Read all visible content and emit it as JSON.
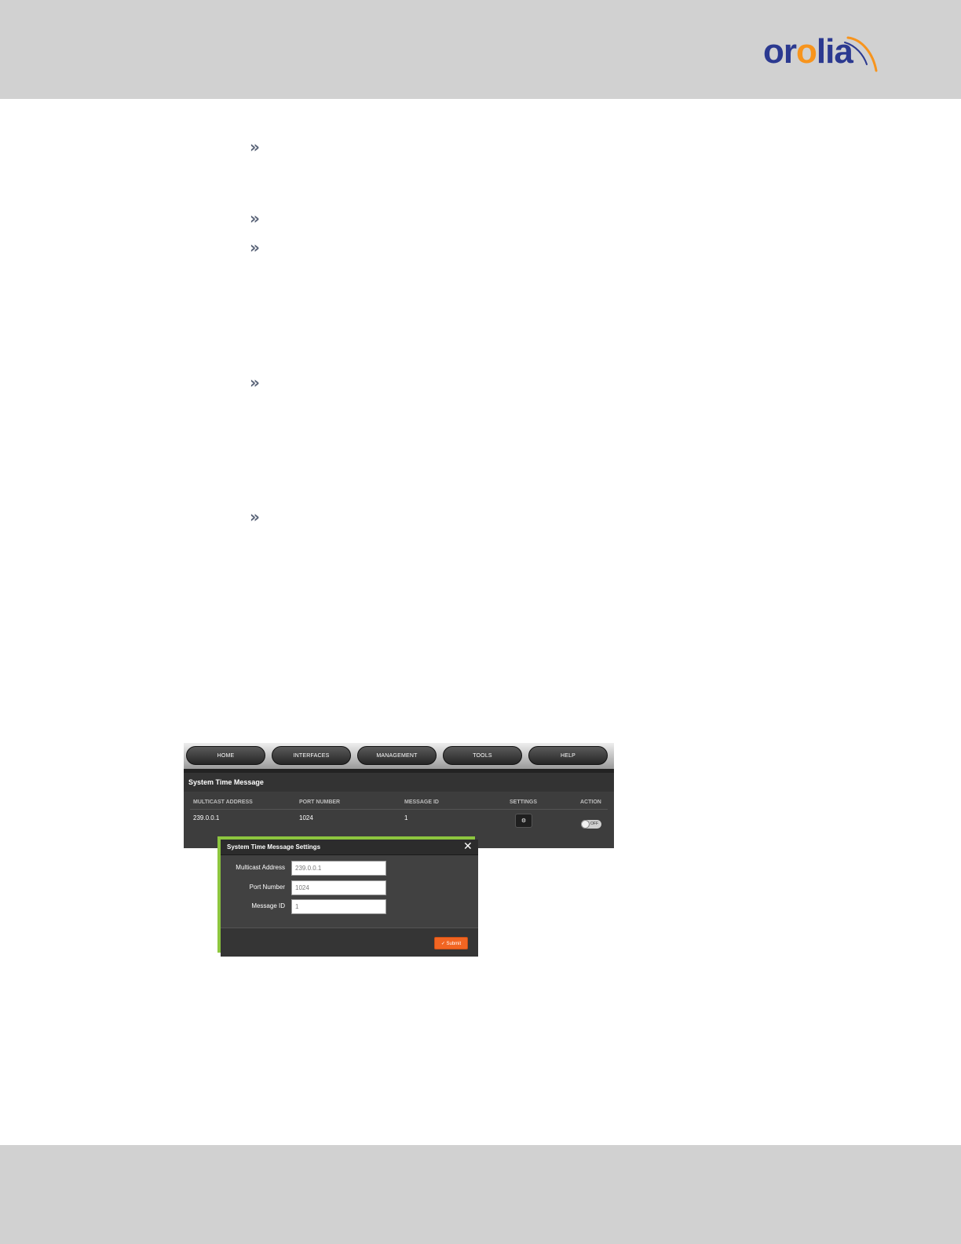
{
  "header": {
    "logo_text_prefix": "or",
    "logo_text_accent": "o",
    "logo_text_suffix": "lia",
    "logo_color": "#2b3990",
    "logo_accent_color": "#f7941d"
  },
  "bullets": [
    "»",
    "»",
    "»",
    "»",
    "»"
  ],
  "nav": {
    "items": [
      "HOME",
      "INTERFACES",
      "MANAGEMENT",
      "TOOLS",
      "HELP"
    ]
  },
  "panel": {
    "title": "System Time Message",
    "columns": [
      "MULTICAST ADDRESS",
      "PORT NUMBER",
      "MESSAGE ID",
      "SETTINGS",
      "ACTION"
    ],
    "row": {
      "multicast_address": "239.0.0.1",
      "port_number": "1024",
      "message_id": "1",
      "settings_icon": "gear-icon",
      "action_toggle": "OFF"
    }
  },
  "modal": {
    "title": "System Time Message Settings",
    "close_icon": "close-icon",
    "fields": [
      {
        "label": "Multicast Address",
        "value": "239.0.0.1"
      },
      {
        "label": "Port Number",
        "value": "1024"
      },
      {
        "label": "Message ID",
        "value": "1"
      }
    ],
    "submit_label": "✓ Submit",
    "accent_color": "#8dc63f",
    "submit_color": "#f26522"
  }
}
